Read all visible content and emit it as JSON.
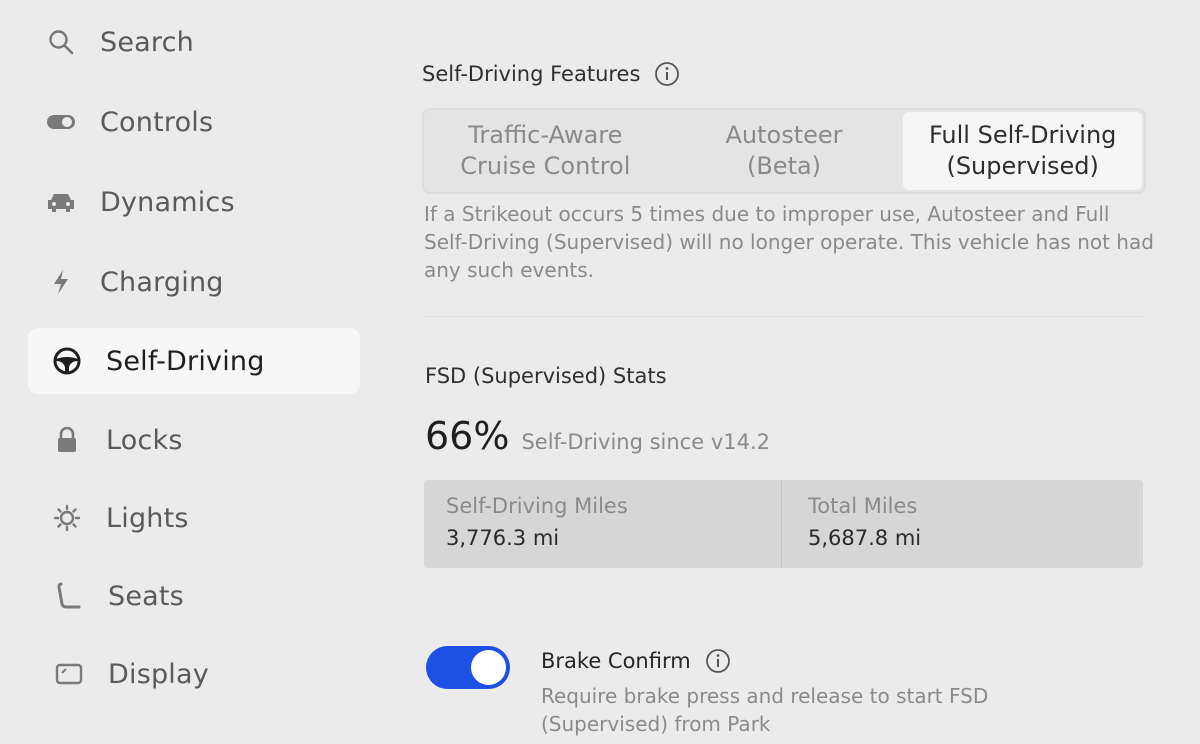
{
  "sidebar": {
    "items": [
      {
        "label": "Search",
        "icon": "search-icon"
      },
      {
        "label": "Controls",
        "icon": "toggle-icon"
      },
      {
        "label": "Dynamics",
        "icon": "car-icon"
      },
      {
        "label": "Charging",
        "icon": "lightning-icon"
      },
      {
        "label": "Self-Driving",
        "icon": "steering-wheel-icon",
        "active": true
      },
      {
        "label": "Locks",
        "icon": "lock-icon"
      },
      {
        "label": "Lights",
        "icon": "sun-icon"
      },
      {
        "label": "Seats",
        "icon": "seat-icon"
      },
      {
        "label": "Display",
        "icon": "display-icon"
      }
    ]
  },
  "features": {
    "title": "Self-Driving Features",
    "options": [
      {
        "line1": "Traffic-Aware",
        "line2": "Cruise Control"
      },
      {
        "line1": "Autosteer",
        "line2": "(Beta)"
      },
      {
        "line1": "Full Self-Driving",
        "line2": "(Supervised)",
        "selected": true
      }
    ],
    "description": "If a Strikeout occurs 5 times due to improper use, Autosteer and Full Self-Driving (Supervised) will no longer operate. This vehicle has not had any such events."
  },
  "stats": {
    "title": "FSD (Supervised) Stats",
    "percent": "66%",
    "percent_caption": "Self-Driving since v14.2",
    "self_driving_label": "Self-Driving Miles",
    "self_driving_value": "3,776.3 mi",
    "total_label": "Total Miles",
    "total_value": "5,687.8 mi"
  },
  "brake_confirm": {
    "title": "Brake Confirm",
    "enabled": true,
    "description": "Require brake press and release to start FSD (Supervised) from Park"
  },
  "colors": {
    "accent": "#1e50e6",
    "background": "#ebebeb"
  }
}
